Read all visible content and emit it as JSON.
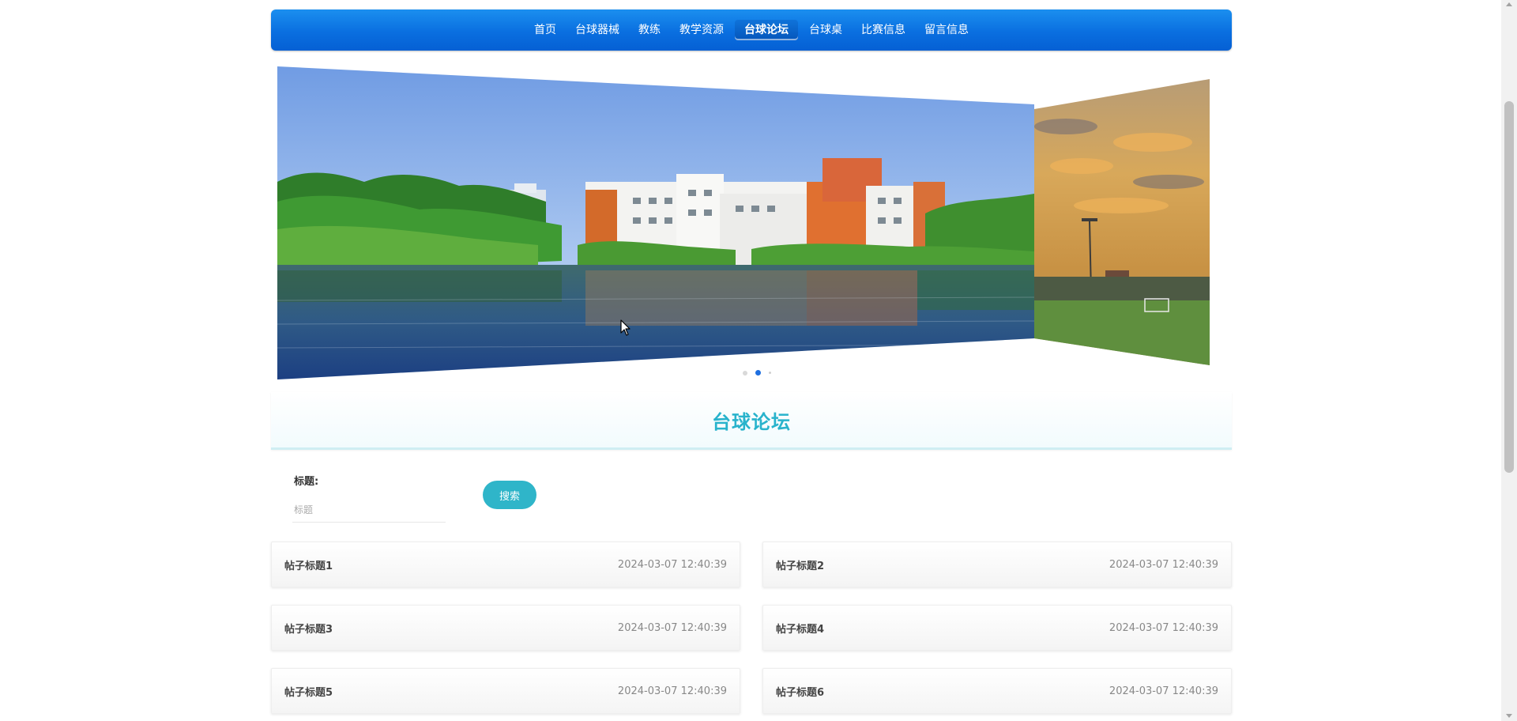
{
  "nav": {
    "items": [
      {
        "label": "首页",
        "active": false
      },
      {
        "label": "台球器械",
        "active": false
      },
      {
        "label": "教练",
        "active": false
      },
      {
        "label": "教学资源",
        "active": false
      },
      {
        "label": "台球论坛",
        "active": true
      },
      {
        "label": "台球桌",
        "active": false
      },
      {
        "label": "比赛信息",
        "active": false
      },
      {
        "label": "留言信息",
        "active": false
      }
    ]
  },
  "carousel": {
    "slide_count": 3,
    "active_index": 1
  },
  "section": {
    "title": "台球论坛"
  },
  "search": {
    "label": "标题:",
    "placeholder": "标题",
    "value": "",
    "button_label": "搜索"
  },
  "posts": [
    {
      "title": "帖子标题1",
      "time": "2024-03-07 12:40:39"
    },
    {
      "title": "帖子标题2",
      "time": "2024-03-07 12:40:39"
    },
    {
      "title": "帖子标题3",
      "time": "2024-03-07 12:40:39"
    },
    {
      "title": "帖子标题4",
      "time": "2024-03-07 12:40:39"
    },
    {
      "title": "帖子标题5",
      "time": "2024-03-07 12:40:39"
    },
    {
      "title": "帖子标题6",
      "time": "2024-03-07 12:40:39"
    }
  ],
  "colors": {
    "nav_blue": "#0a6fe0",
    "accent_teal": "#2fb5c9",
    "title_teal": "#29b3cc"
  }
}
